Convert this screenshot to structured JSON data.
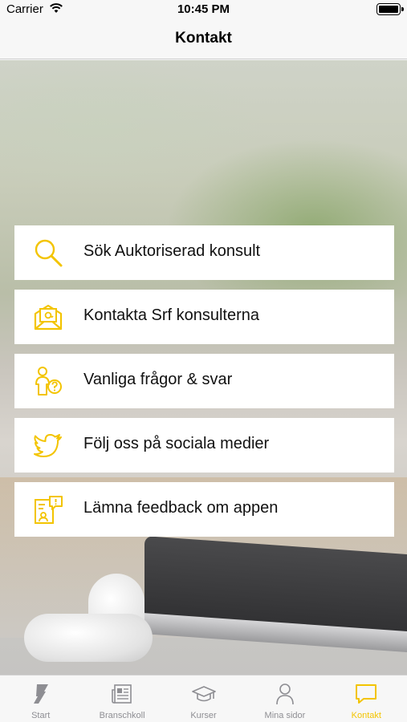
{
  "status_bar": {
    "carrier": "Carrier",
    "time": "10:45 PM"
  },
  "nav": {
    "title": "Kontakt"
  },
  "menu": {
    "items": [
      {
        "label": "Sök Auktoriserad konsult",
        "icon": "search-icon"
      },
      {
        "label": "Kontakta Srf konsulterna",
        "icon": "email-icon"
      },
      {
        "label": "Vanliga frågor & svar",
        "icon": "faq-person-icon"
      },
      {
        "label": "Följ oss på sociala medier",
        "icon": "twitter-icon"
      },
      {
        "label": "Lämna feedback om appen",
        "icon": "feedback-icon"
      }
    ]
  },
  "tabs": [
    {
      "label": "Start",
      "icon": "srf-logo-icon",
      "active": false
    },
    {
      "label": "Branschkoll",
      "icon": "newspaper-icon",
      "active": false
    },
    {
      "label": "Kurser",
      "icon": "graduation-cap-icon",
      "active": false
    },
    {
      "label": "Mina sidor",
      "icon": "person-icon",
      "active": false
    },
    {
      "label": "Kontakt",
      "icon": "chat-bubble-icon",
      "active": true
    }
  ],
  "colors": {
    "accent": "#F3C400",
    "inactive": "#8E8E93",
    "card": "#FFFFFF",
    "bar": "#F7F7F7"
  }
}
